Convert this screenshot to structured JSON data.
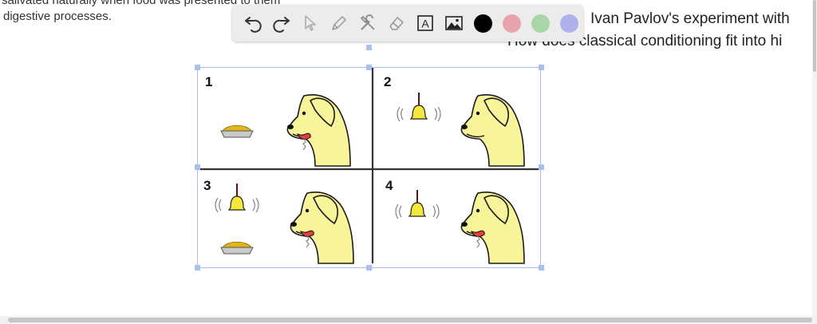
{
  "document": {
    "left_lines": [
      "salivated naturally when food was presented to them",
      "digestive processes."
    ],
    "right_lines": [
      "Ivan Pavlov's experiment with",
      "How does classical conditioning fit into hi"
    ]
  },
  "toolbar": {
    "tools": [
      {
        "icon": "undo-icon"
      },
      {
        "icon": "redo-icon"
      },
      {
        "icon": "select-arrow-icon"
      },
      {
        "icon": "pen-icon"
      },
      {
        "icon": "tools-icon"
      },
      {
        "icon": "eraser-icon"
      },
      {
        "icon": "text-box-icon",
        "glyph": "A"
      },
      {
        "icon": "image-icon"
      }
    ],
    "colors": [
      "#000000",
      "#e8a4ad",
      "#a9d6a9",
      "#b0b0ec"
    ]
  },
  "figure": {
    "panels": [
      {
        "number": "1"
      },
      {
        "number": "2"
      },
      {
        "number": "3"
      },
      {
        "number": "4"
      }
    ]
  }
}
